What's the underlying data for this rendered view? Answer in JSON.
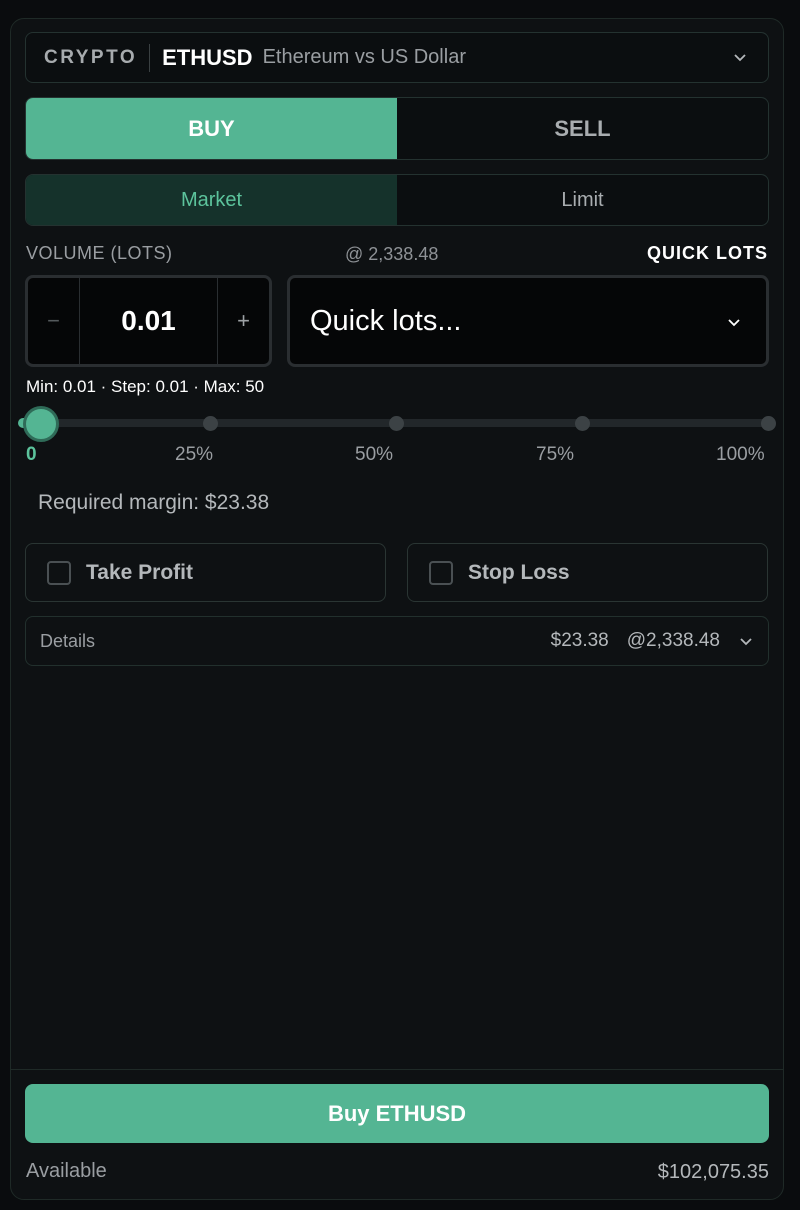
{
  "symbol": {
    "category": "CRYPTO",
    "ticker": "ETHUSD",
    "description": "Ethereum vs US Dollar",
    "chevron_icon": "chevron-down-icon"
  },
  "side": {
    "buy_label": "BUY",
    "sell_label": "SELL",
    "selected": "BUY"
  },
  "order_type": {
    "market_label": "Market",
    "limit_label": "Limit",
    "selected": "Market"
  },
  "volume": {
    "label": "VOLUME (LOTS)",
    "price_at": "@ 2,338.48",
    "quick_lots_label": "QUICK LOTS",
    "minus": "−",
    "value": "0.01",
    "plus": "+",
    "quick_lots_placeholder": "Quick lots...",
    "limits_text": "Min: 0.01 · Step: 0.01 · Max: 50"
  },
  "slider": {
    "level_percent": 0,
    "ticks": [
      "0",
      "25%",
      "50%",
      "75%",
      "100%"
    ]
  },
  "required_margin": "Required margin: $23.38",
  "options": {
    "take_profit": "Take Profit",
    "stop_loss": "Stop Loss"
  },
  "details": {
    "label": "Details",
    "amount": "$23.38",
    "price": "@2,338.48"
  },
  "submit_label": "Buy ETHUSD",
  "available": {
    "label": "Available",
    "value": "$102,075.35"
  },
  "colors": {
    "accent": "#54b593",
    "accent_text": "#5cc39c",
    "background": "#0a0c0e"
  }
}
